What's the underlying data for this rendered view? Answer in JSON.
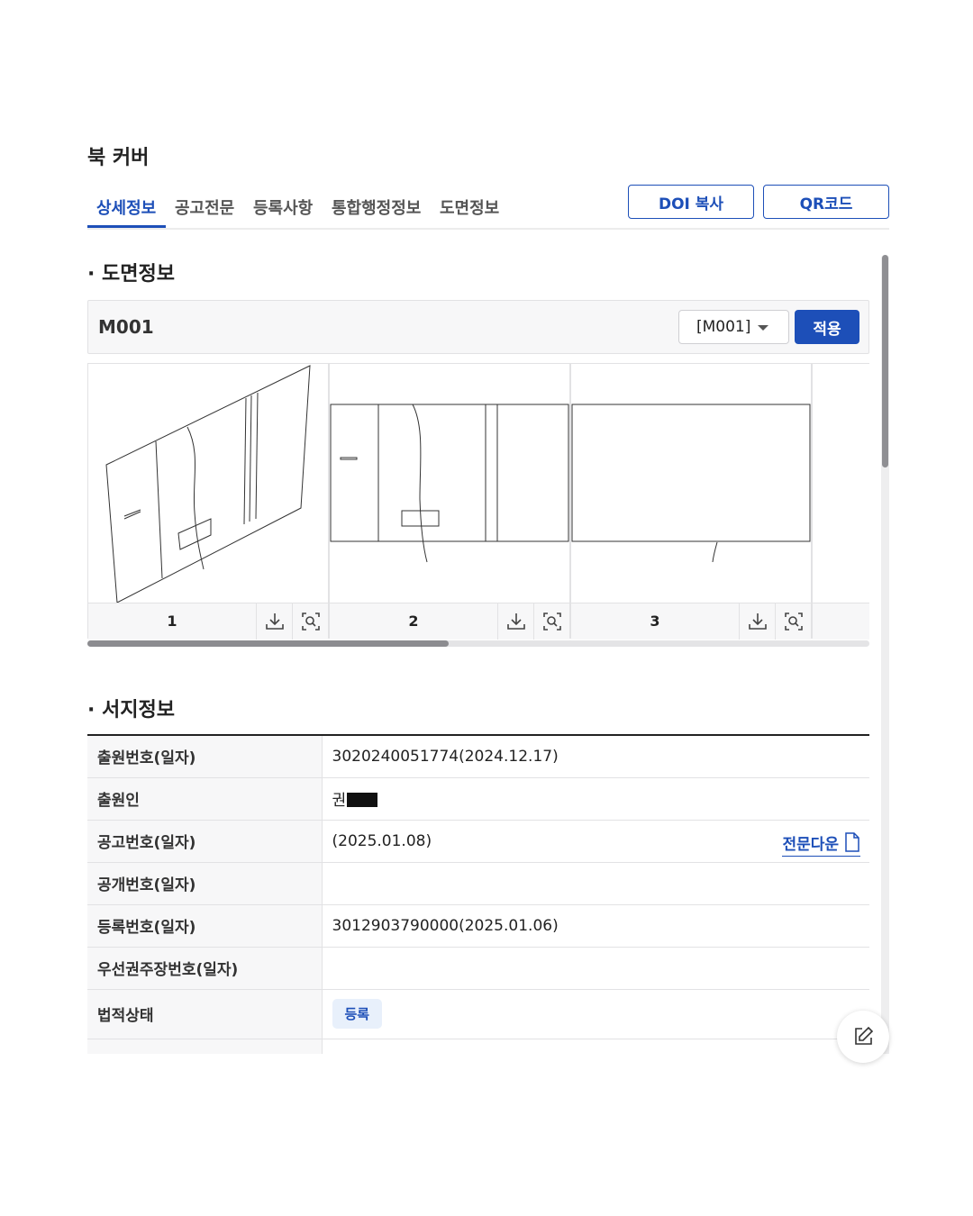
{
  "page": {
    "title": "북 커버"
  },
  "tabs": [
    {
      "label": "상세정보",
      "active": true
    },
    {
      "label": "공고전문",
      "active": false
    },
    {
      "label": "등록사항",
      "active": false
    },
    {
      "label": "통합행정정보",
      "active": false
    },
    {
      "label": "도면정보",
      "active": false
    }
  ],
  "actions": {
    "doi_copy": "DOI 복사",
    "qr_code": "QR코드"
  },
  "drawing_section": {
    "heading": "· 도면정보",
    "current_code": "M001",
    "select_value": "[M001]",
    "apply_label": "적용",
    "thumbnails": [
      {
        "number": "1",
        "download_icon": "download-icon",
        "zoom_icon": "zoom-icon"
      },
      {
        "number": "2",
        "download_icon": "download-icon",
        "zoom_icon": "zoom-icon"
      },
      {
        "number": "3",
        "download_icon": "download-icon",
        "zoom_icon": "zoom-icon"
      }
    ]
  },
  "bibliographic_section": {
    "heading": "· 서지정보",
    "rows": [
      {
        "key": "출원번호(일자)",
        "value": "3020240051774(2024.12.17)"
      },
      {
        "key": "출원인",
        "value": "권"
      },
      {
        "key": "공고번호(일자)",
        "value": "(2025.01.08)",
        "link": "전문다운"
      },
      {
        "key": "공개번호(일자)",
        "value": ""
      },
      {
        "key": "등록번호(일자)",
        "value": "3012903790000(2025.01.06)"
      },
      {
        "key": "우선권주장번호(일자)",
        "value": ""
      },
      {
        "key": "법적상태",
        "badge": "등록"
      }
    ]
  },
  "colors": {
    "accent": "#1d4fb8",
    "badge_bg": "#e8f0fb"
  },
  "floating": {
    "icon": "edit-icon"
  }
}
